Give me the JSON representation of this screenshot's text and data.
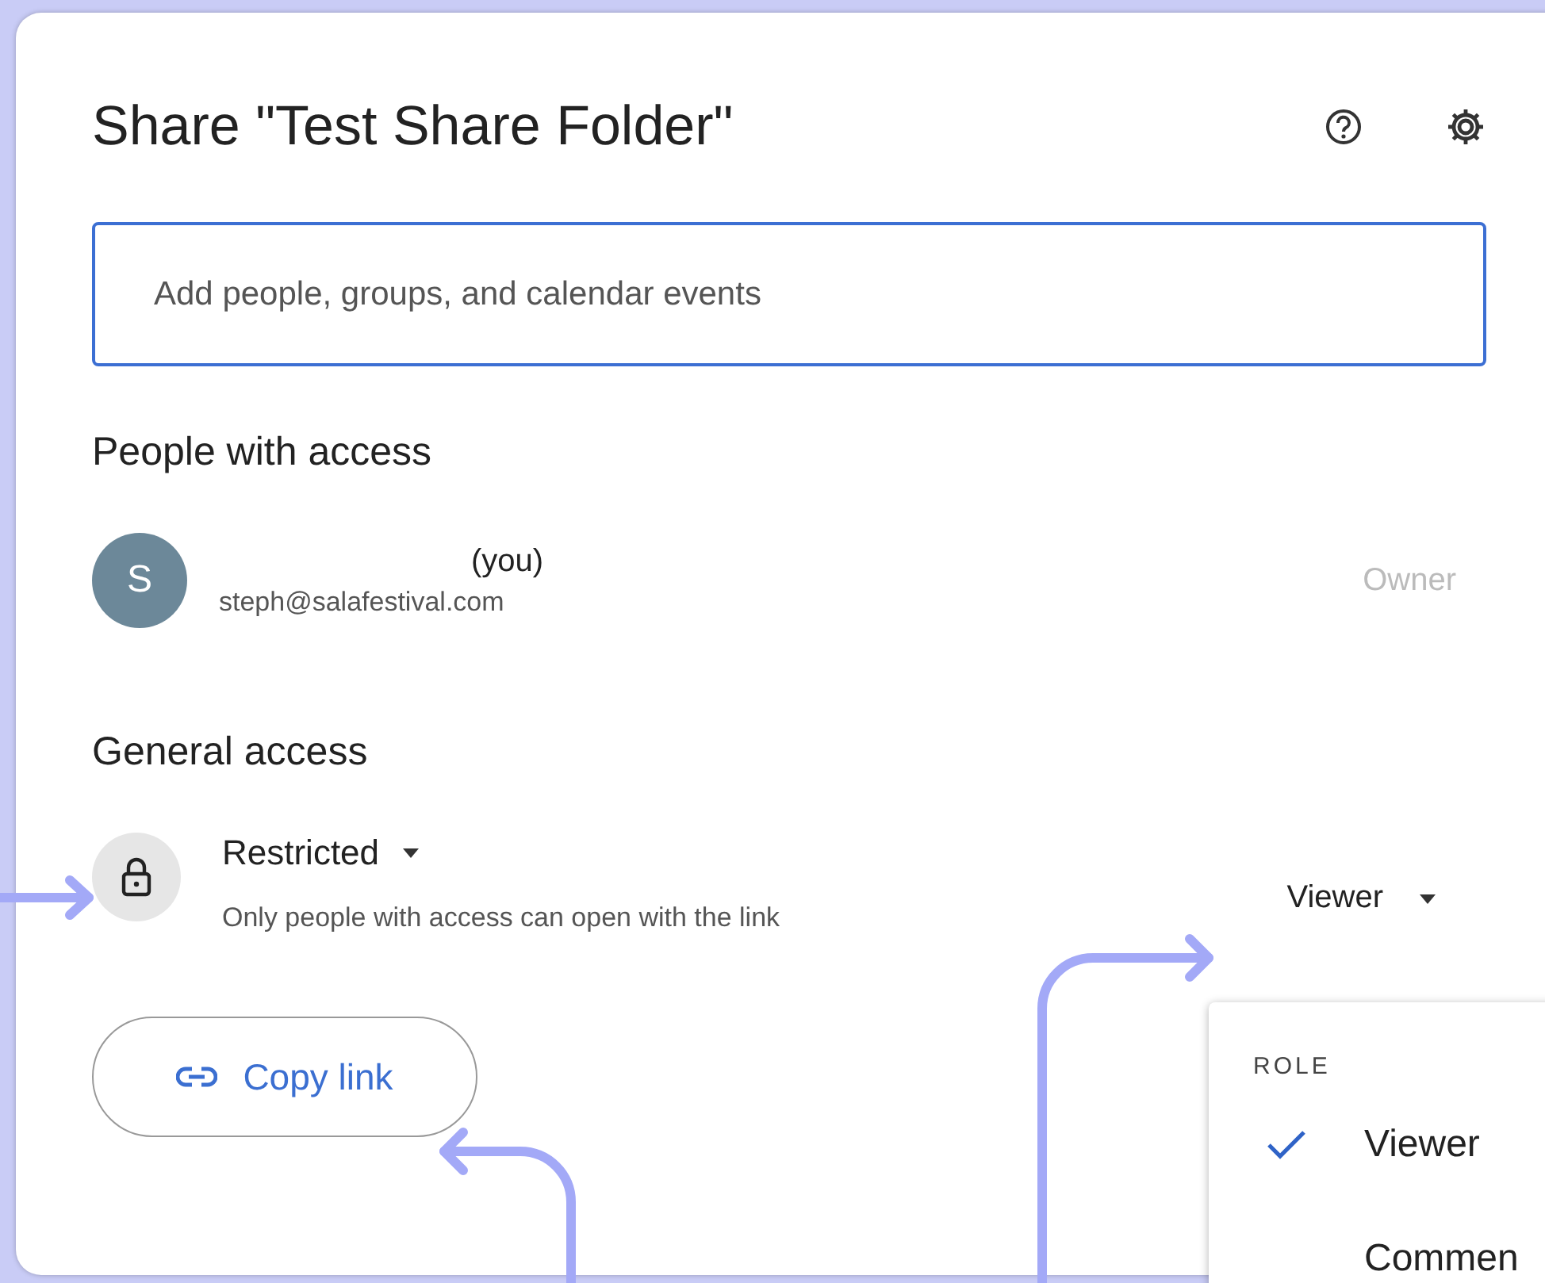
{
  "dialog": {
    "title": "Share \"Test Share Folder\"",
    "search": {
      "placeholder": "Add people, groups, and calendar events"
    },
    "people_heading": "People with access",
    "people": [
      {
        "avatar": "S",
        "name": "(you)",
        "email": "steph@salafestival.com",
        "role": "Owner"
      }
    ],
    "general_heading": "General access",
    "access": {
      "label": "Restricted",
      "description": "Only people with access can open with the link",
      "role": "Viewer"
    },
    "copy_link": "Copy link"
  },
  "role_menu": {
    "heading": "ROLE",
    "items": [
      {
        "label": "Viewer",
        "selected": true
      },
      {
        "label": "Commen",
        "selected": false
      }
    ]
  }
}
